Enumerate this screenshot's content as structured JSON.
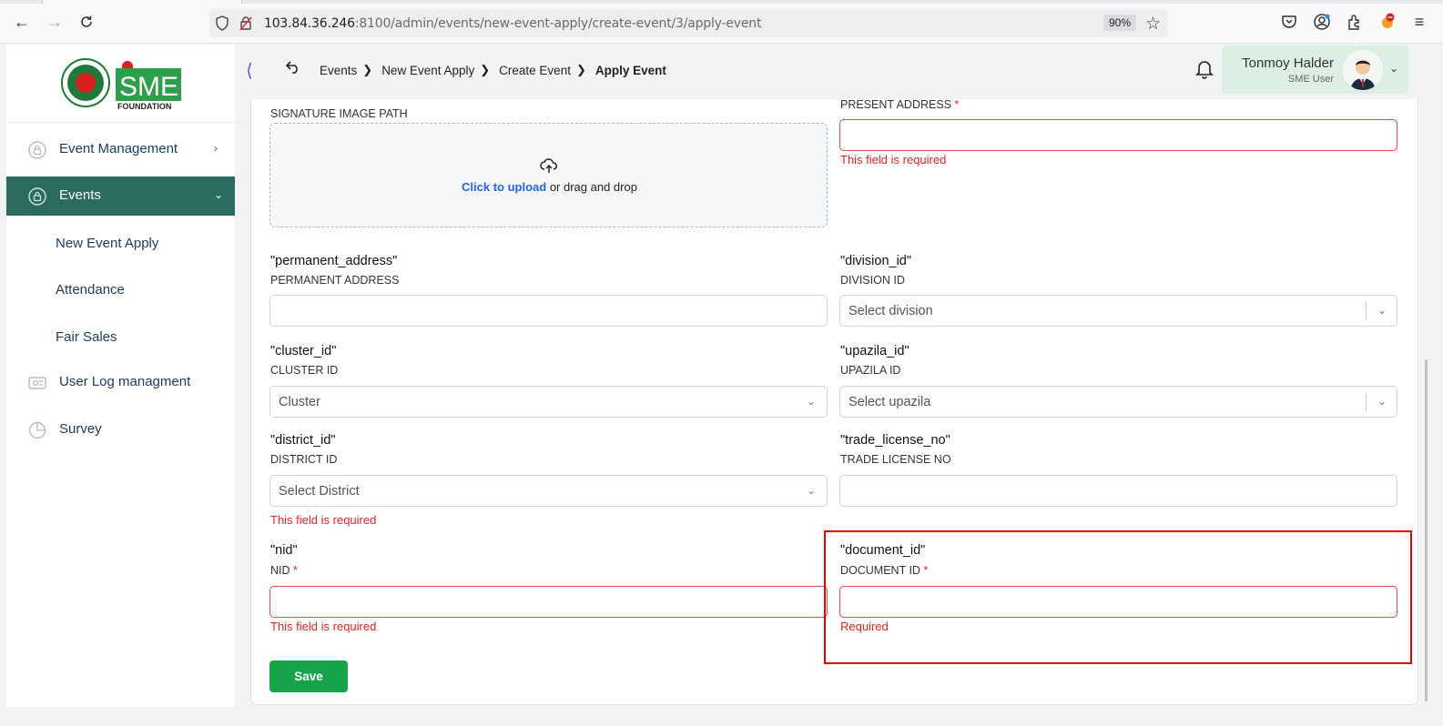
{
  "browser": {
    "url_host": "103.84.36.246",
    "url_rest": ":8100/admin/events/new-event-apply/create-event/3/apply-event",
    "zoom": "90%"
  },
  "sidebar": {
    "items": [
      {
        "label": "Event Management",
        "icon": "lock-icon"
      },
      {
        "label": "Events",
        "icon": "lock-icon"
      },
      {
        "label": "New Event Apply"
      },
      {
        "label": "Attendance"
      },
      {
        "label": "Fair Sales"
      },
      {
        "label": "User Log managment",
        "icon": "log-icon"
      },
      {
        "label": "Survey",
        "icon": "pie-chart-icon"
      }
    ],
    "logo_text": "SME",
    "logo_sub": "FOUNDATION"
  },
  "header": {
    "breadcrumbs": [
      "Events",
      "New Event Apply",
      "Create Event",
      "Apply Event"
    ],
    "user_name": "Tonmoy Halder",
    "user_role": "SME User"
  },
  "form": {
    "signature": {
      "label": "SIGNATURE IMAGE PATH",
      "upload_link": "Click to upload",
      "upload_rest": " or drag and drop"
    },
    "present_address": {
      "label": "PRESENT ADDRESS",
      "required": "*",
      "error": "This field is required"
    },
    "permanent_address": {
      "key": "\"permanent_address\"",
      "label": "PERMANENT ADDRESS"
    },
    "division_id": {
      "key": "\"division_id\"",
      "label": "DIVISION ID",
      "placeholder": "Select division"
    },
    "cluster_id": {
      "key": "\"cluster_id\"",
      "label": "CLUSTER ID",
      "placeholder": "Cluster"
    },
    "upazila_id": {
      "key": "\"upazila_id\"",
      "label": "UPAZILA ID",
      "placeholder": "Select upazila"
    },
    "district_id": {
      "key": "\"district_id\"",
      "label": "DISTRICT ID",
      "placeholder": "Select District",
      "error": "This field is required"
    },
    "trade_license_no": {
      "key": "\"trade_license_no\"",
      "label": "TRADE LICENSE NO"
    },
    "nid": {
      "key": "\"nid\"",
      "label": "NID",
      "required": "*",
      "error": "This field is required"
    },
    "document_id": {
      "key": "\"document_id\"",
      "label": "DOCUMENT ID",
      "required": "*",
      "error": "Required"
    },
    "save_label": "Save"
  },
  "colors": {
    "sidebar_active": "#2c6b60",
    "error": "#e02424",
    "save": "#16a34a",
    "link": "#2563eb",
    "highlight": "#e00000"
  }
}
